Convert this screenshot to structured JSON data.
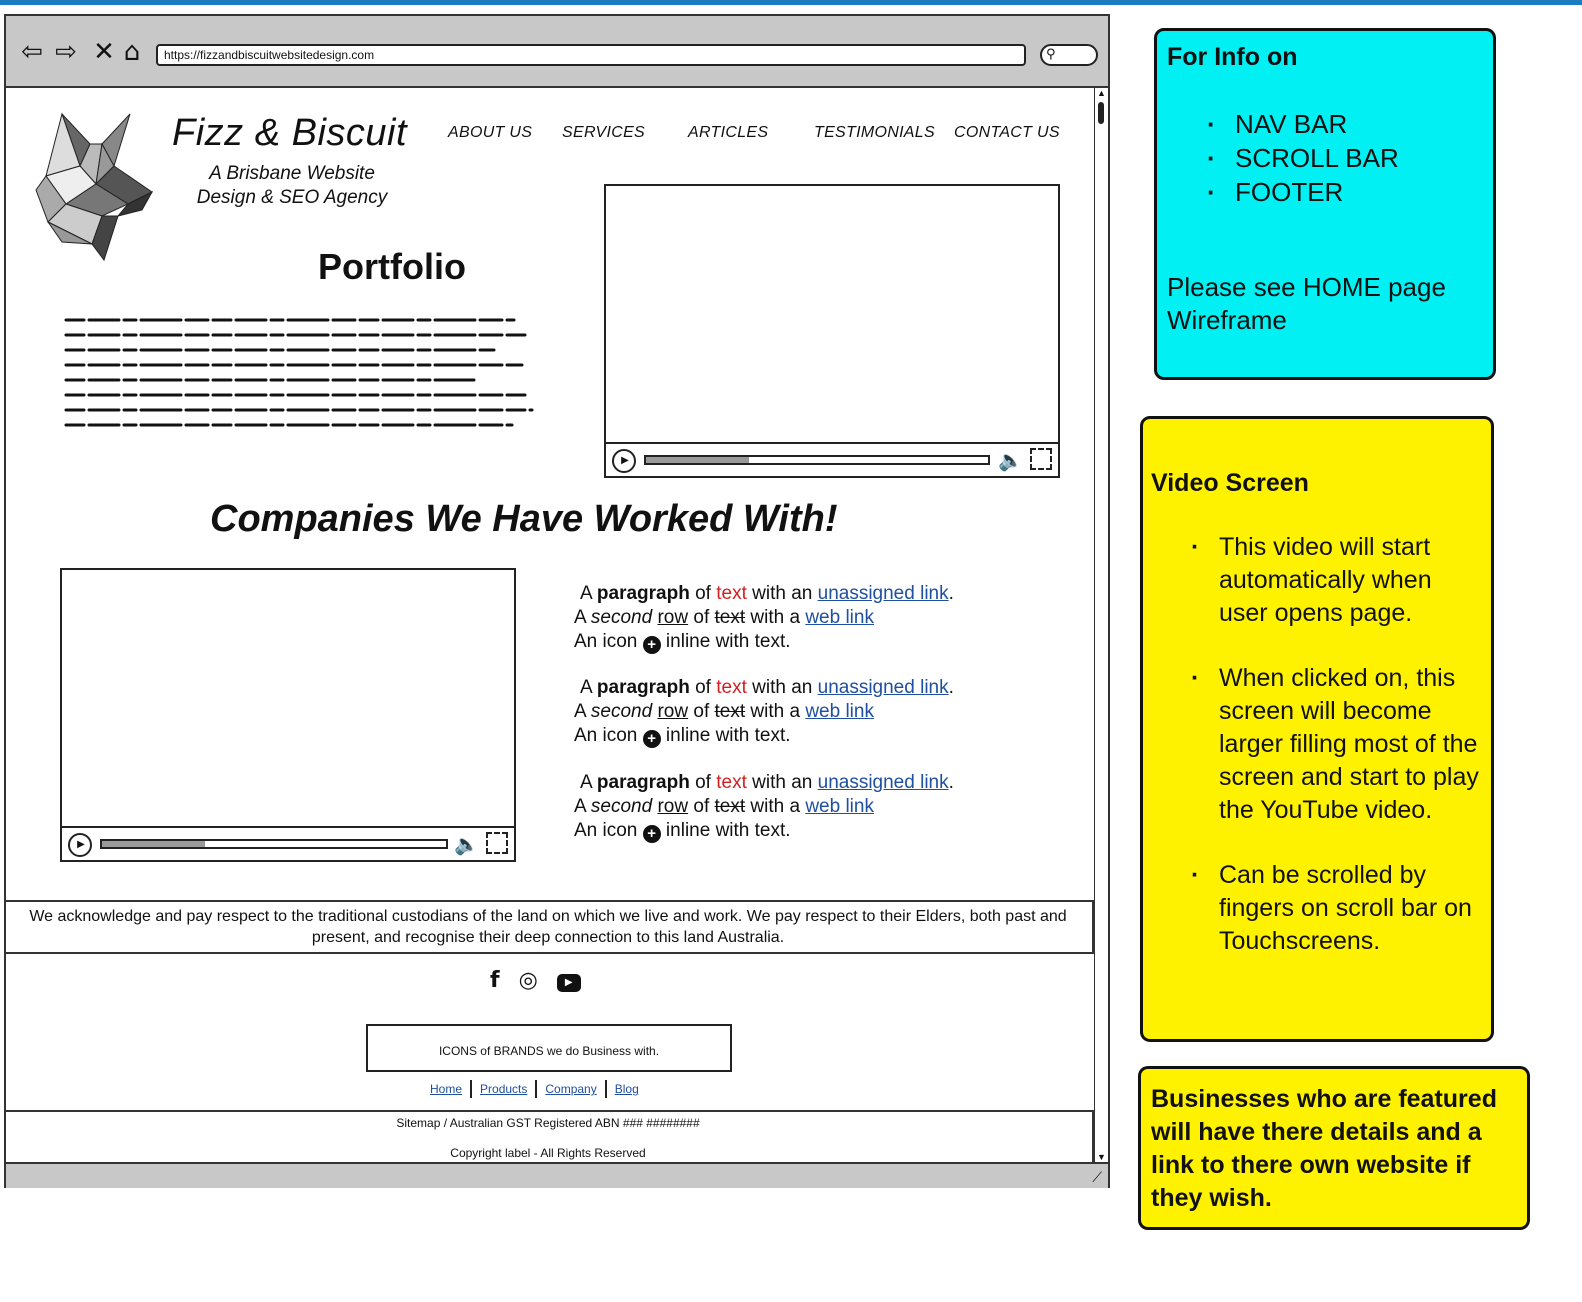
{
  "browser": {
    "url": "https://fizzandbiscuitwebsitedesign.com",
    "back_icon": "arrow-left-icon",
    "forward_icon": "arrow-right-icon",
    "close_icon": "close-icon",
    "home_icon": "home-icon"
  },
  "header": {
    "brand": "Fizz & Biscuit",
    "tagline": "A Brisbane Website Design & SEO Agency",
    "nav": [
      "ABOUT US",
      "SERVICES",
      "ARTICLES",
      "TESTIMONIALS",
      "CONTACT US"
    ]
  },
  "main": {
    "portfolio_title": "Portfolio",
    "companies_title": "Companies We Have Worked With!",
    "paragraphs": [
      {
        "a": "A ",
        "bold": "paragraph",
        "of": " of ",
        "red": "text",
        "with_an": " with an ",
        "link1": "unassigned link",
        "dot": ".",
        "b_a": "A ",
        "b_italic": "second",
        "b_sp": " ",
        "b_under": "row",
        "b_of": " of ",
        "b_strike": "text",
        "b_with": " with a ",
        "b_link": "web link",
        "c_pre": "An icon ",
        "c_post": " inline with text."
      },
      {
        "a": "A ",
        "bold": "paragraph",
        "of": " of ",
        "red": "text",
        "with_an": " with an ",
        "link1": "unassigned link",
        "dot": ".",
        "b_a": "A ",
        "b_italic": "second",
        "b_sp": " ",
        "b_under": "row",
        "b_of": " of ",
        "b_strike": "text",
        "b_with": " with a ",
        "b_link": "web link",
        "c_pre": "An icon ",
        "c_post": " inline with text."
      },
      {
        "a": "A ",
        "bold": "paragraph",
        "of": " of ",
        "red": "text",
        "with_an": " with an ",
        "link1": "unassigned link",
        "dot": ".",
        "b_a": "A ",
        "b_italic": "second",
        "b_sp": " ",
        "b_under": "row",
        "b_of": " of ",
        "b_strike": "text",
        "b_with": " with a ",
        "b_link": "web link",
        "c_pre": "An icon ",
        "c_post": " inline with text."
      }
    ],
    "video_top_progress": 0.3,
    "video_bottom_progress": 0.3
  },
  "footer": {
    "acknowledgement": "We acknowledge and pay respect to the traditional custodians of the land on which we live and work. We pay respect to their Elders, both past and present, and recognise their deep connection to this land Australia.",
    "social_icons": [
      "facebook-icon",
      "instagram-icon",
      "youtube-icon"
    ],
    "brands_box": "ICONS of BRANDS we do Business with.",
    "links": [
      "Home",
      "Products",
      "Company",
      "Blog"
    ],
    "sitemap": "Sitemap / Australian GST Registered ABN ### ########",
    "copyright": "Copyright label - All Rights Reserved"
  },
  "notes": {
    "info": {
      "title": "For Info on",
      "items": [
        "NAV BAR",
        "SCROLL BAR",
        "FOOTER"
      ],
      "footer": "Please see HOME page Wireframe"
    },
    "video": {
      "title": "Video Screen",
      "items": [
        "This video will start automatically when user opens page.",
        "When clicked on, this screen will become larger filling most of the screen and start to play the YouTube video.",
        "Can be scrolled by fingers on scroll bar on Touchscreens."
      ]
    },
    "businesses": "Businesses who are featured will have there details and a link to there own website if they wish."
  },
  "colors": {
    "note_cyan": "#00f0f4",
    "note_yellow": "#fff200",
    "link": "#1f4fa0",
    "red_text": "#d21f1f",
    "top_accent": "#1c7cc0"
  }
}
